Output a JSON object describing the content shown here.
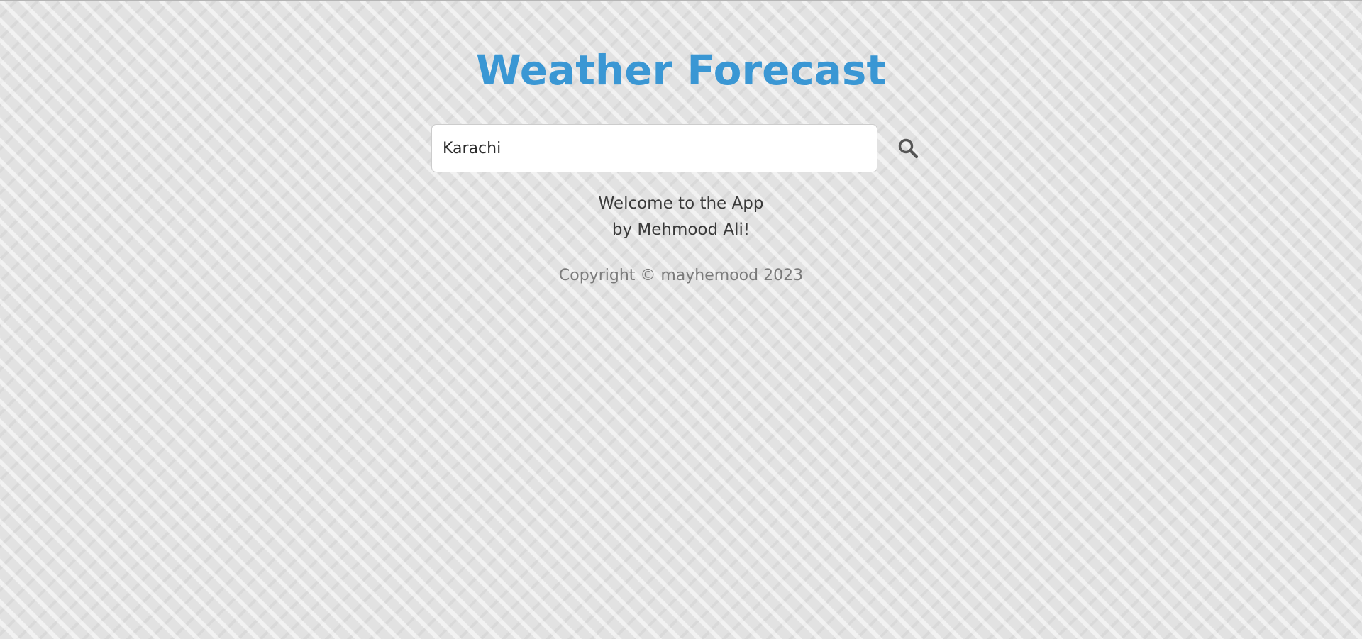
{
  "header": {
    "title": "Weather Forecast",
    "title_color": "#3a97d4"
  },
  "search": {
    "value": "Karachi",
    "icon": "search-icon",
    "icon_color": "#555555"
  },
  "welcome": {
    "line1": "Welcome to the App",
    "line2": "by Mehmood Ali!"
  },
  "footer": {
    "copyright": "Copyright © mayhemood 2023"
  }
}
